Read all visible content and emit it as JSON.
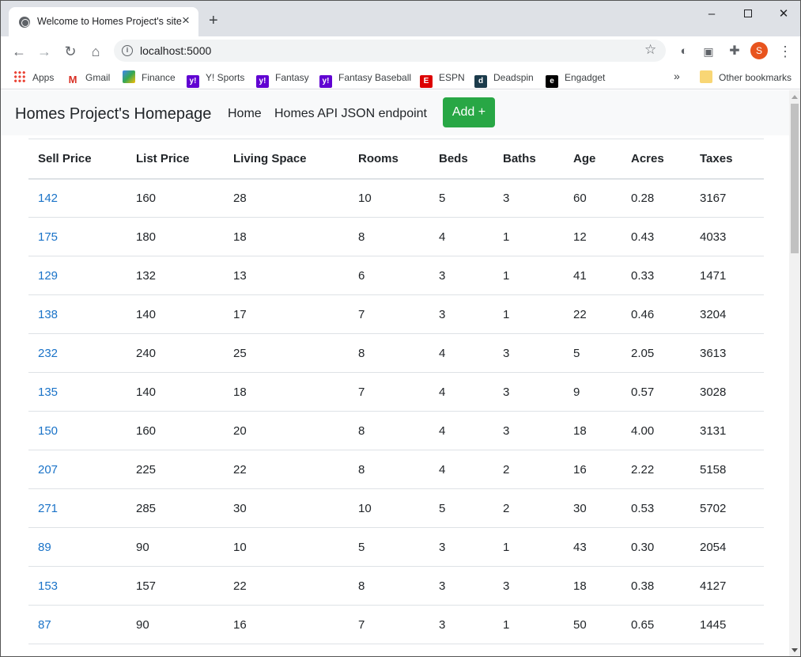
{
  "browser": {
    "tab_title": "Welcome to Homes Project's site",
    "url": "localhost:5000",
    "profile_initial": "S",
    "bookmarks": [
      "Apps",
      "Gmail",
      "Finance",
      "Y! Sports",
      "Fantasy",
      "Fantasy Baseball",
      "ESPN",
      "Deadspin",
      "Engadget"
    ],
    "other_bookmarks": "Other bookmarks"
  },
  "navbar": {
    "brand": "Homes Project's Homepage",
    "links": [
      "Home",
      "Homes API JSON endpoint"
    ],
    "add_button": "Add +"
  },
  "table": {
    "headers": [
      "Sell Price",
      "List Price",
      "Living Space",
      "Rooms",
      "Beds",
      "Baths",
      "Age",
      "Acres",
      "Taxes"
    ],
    "rows": [
      [
        "142",
        "160",
        "28",
        "10",
        "5",
        "3",
        "60",
        "0.28",
        "3167"
      ],
      [
        "175",
        "180",
        "18",
        "8",
        "4",
        "1",
        "12",
        "0.43",
        "4033"
      ],
      [
        "129",
        "132",
        "13",
        "6",
        "3",
        "1",
        "41",
        "0.33",
        "1471"
      ],
      [
        "138",
        "140",
        "17",
        "7",
        "3",
        "1",
        "22",
        "0.46",
        "3204"
      ],
      [
        "232",
        "240",
        "25",
        "8",
        "4",
        "3",
        "5",
        "2.05",
        "3613"
      ],
      [
        "135",
        "140",
        "18",
        "7",
        "4",
        "3",
        "9",
        "0.57",
        "3028"
      ],
      [
        "150",
        "160",
        "20",
        "8",
        "4",
        "3",
        "18",
        "4.00",
        "3131"
      ],
      [
        "207",
        "225",
        "22",
        "8",
        "4",
        "2",
        "16",
        "2.22",
        "5158"
      ],
      [
        "271",
        "285",
        "30",
        "10",
        "5",
        "2",
        "30",
        "0.53",
        "5702"
      ],
      [
        "89",
        "90",
        "10",
        "5",
        "3",
        "1",
        "43",
        "0.30",
        "2054"
      ],
      [
        "153",
        "157",
        "22",
        "8",
        "3",
        "3",
        "18",
        "0.38",
        "4127"
      ],
      [
        "87",
        "90",
        "16",
        "7",
        "3",
        "1",
        "50",
        "0.65",
        "1445"
      ]
    ]
  },
  "icons": {
    "tab_favicon": "globe-icon",
    "back": "arrow-left-icon",
    "forward": "arrow-right-icon",
    "reload": "reload-icon",
    "home": "home-icon",
    "info": "info-icon",
    "bookmark_star": "star-icon",
    "extensions": "puzzle-icon",
    "menu": "kebab-menu-icon"
  },
  "colors": {
    "add_button": "#28a745",
    "link": "#1a73c8",
    "navbar_bg": "#f8f9fa"
  }
}
